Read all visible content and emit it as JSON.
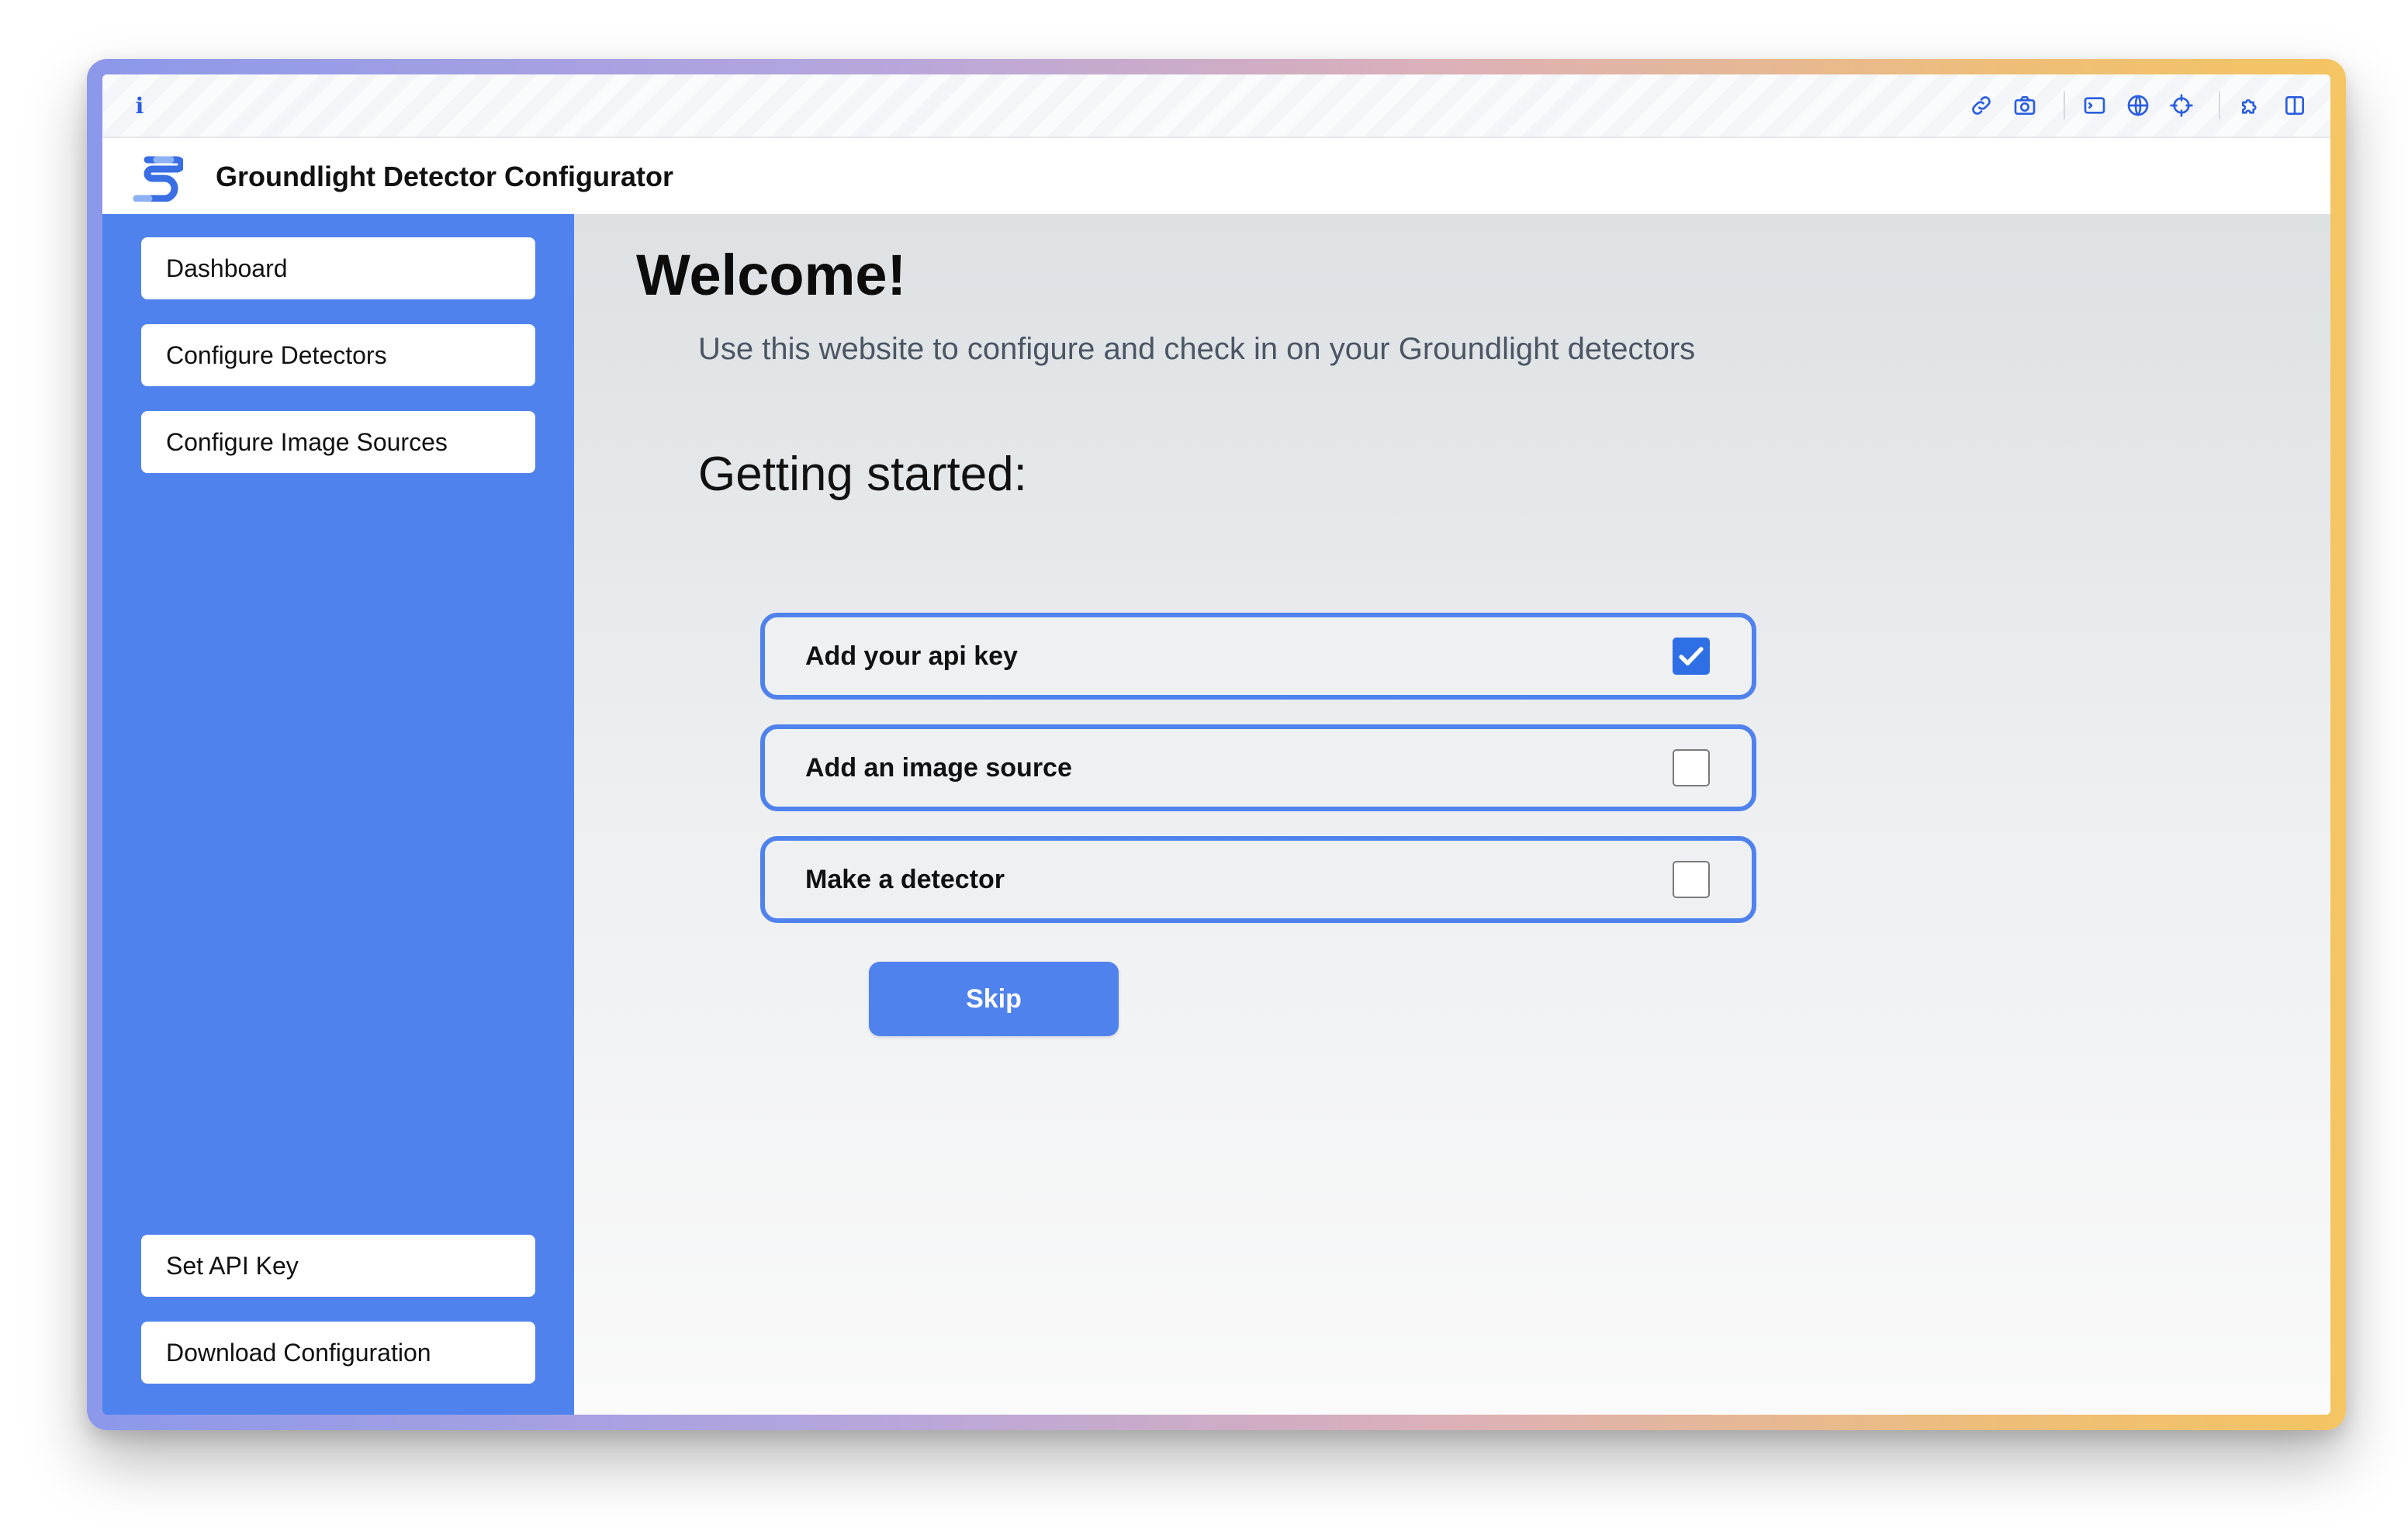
{
  "app": {
    "title": "Groundlight Detector Configurator",
    "logo": "groundlight-logo"
  },
  "chrome": {
    "info_glyph": "i",
    "icons": [
      "link-icon",
      "camera-icon",
      "terminal-icon",
      "globe-icon",
      "crosshair-icon",
      "puzzle-icon",
      "split-panel-icon"
    ]
  },
  "sidebar": {
    "items": [
      {
        "label": "Dashboard"
      },
      {
        "label": "Configure Detectors"
      },
      {
        "label": "Configure Image Sources"
      }
    ],
    "bottom_items": [
      {
        "label": "Set API Key"
      },
      {
        "label": "Download Configuration"
      }
    ]
  },
  "main": {
    "heading": "Welcome!",
    "subtitle": "Use this website to configure and check in on your Groundlight detectors",
    "getting_started_title": "Getting started:",
    "tasks": [
      {
        "label": "Add your api key",
        "checked": true
      },
      {
        "label": "Add an image source",
        "checked": false
      },
      {
        "label": "Make a detector",
        "checked": false
      }
    ],
    "skip_label": "Skip"
  },
  "colors": {
    "accent": "#4f82ec",
    "checkbox_checked": "#2f6fe6",
    "chrome_icon": "#2b5ee0"
  }
}
